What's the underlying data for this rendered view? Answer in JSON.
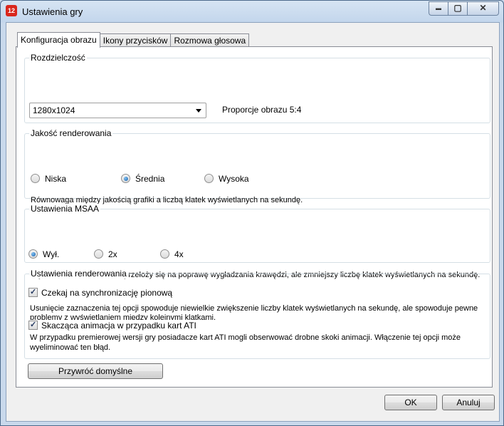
{
  "window": {
    "title": "Ustawienia gry",
    "app_icon_text": "12",
    "minimize_glyph": "▬",
    "maximize_glyph": "▢",
    "close_glyph": "✕"
  },
  "tabs": [
    {
      "label": "Konfiguracja obrazu",
      "active": true
    },
    {
      "label": "Ikony przycisków",
      "active": false
    },
    {
      "label": "Rozmowa głosowa",
      "active": false
    }
  ],
  "resolution": {
    "legend": "Rozdzielczość",
    "selected": "1280x1024",
    "aspect": "Proporcje obrazu 5:4"
  },
  "quality": {
    "legend": "Jakość renderowania",
    "options": [
      {
        "label": "Niska",
        "checked": false
      },
      {
        "label": "Średnia",
        "checked": true
      },
      {
        "label": "Wysoka",
        "checked": false
      }
    ],
    "description": "Równowaga między jakością grafiki a liczbą klatek wyświetlanych na sekundę."
  },
  "msaa": {
    "legend": "Ustawienia MSAA",
    "options": [
      {
        "label": "Wył.",
        "checked": true
      },
      {
        "label": "2x",
        "checked": false
      },
      {
        "label": "4x",
        "checked": false
      }
    ],
    "description": "Wyższe ustawienie MSAA przełoży się na poprawę wygładzania krawędzi, ale zmniejszy liczbę klatek wyświetlanych na sekundę."
  },
  "render_settings": {
    "legend": "Ustawienia renderowania",
    "vsync": {
      "label": "Czekaj na synchronizację pionową",
      "checked": true,
      "desc_line1": "Usunięcie zaznaczenia tej opcji spowoduje niewielkie zwiększenie liczby klatek wyświetlanych na sekundę, ale spowoduje pewne",
      "desc_line2": "problemy z wyświetlaniem między kolejnymi klatkami."
    },
    "ati": {
      "label": "Skacząca animacja w przypadku kart ATI",
      "checked": true,
      "desc_line1": "W przypadku premierowej wersji gry posiadacze kart ATI mogli obserwować drobne skoki animacji. Włączenie tej opcji może",
      "desc_line2": "wyeliminować ten błąd."
    }
  },
  "buttons": {
    "restore_defaults": "Przywróć domyślne",
    "ok": "OK",
    "cancel": "Anuluj"
  },
  "check_glyph": "✓"
}
